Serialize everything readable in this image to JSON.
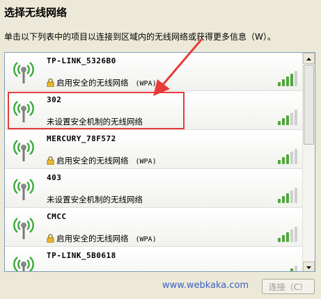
{
  "title": "选择无线网络",
  "description": "单击以下列表中的项目以连接到区域内的无线网络或获得更多信息（W）。",
  "networks": [
    {
      "ssid": "TP-LINK_5326B0",
      "status": "启用安全的无线网络",
      "security": "(WPA)",
      "secured": true,
      "signal_bars": 4
    },
    {
      "ssid": "302",
      "status": "未设置安全机制的无线网络",
      "security": "",
      "secured": false,
      "signal_bars": 3
    },
    {
      "ssid": "MERCURY_78F572",
      "status": "启用安全的无线网络",
      "security": "(WPA)",
      "secured": true,
      "signal_bars": 3
    },
    {
      "ssid": "403",
      "status": "未设置安全机制的无线网络",
      "security": "",
      "secured": false,
      "signal_bars": 3
    },
    {
      "ssid": "CMCC",
      "status": "启用安全的无线网络",
      "security": "(WPA)",
      "secured": true,
      "signal_bars": 3
    },
    {
      "ssid": "TP-LINK_5B0618",
      "status": "",
      "security": "",
      "secured": false,
      "signal_bars": 4
    }
  ],
  "footer": {
    "watermark": "www.webkaka.com",
    "connect_label": "连接（C）"
  },
  "colors": {
    "highlight": "#e73a3a",
    "signal_active": "#4fa83a",
    "signal_inactive": "#cfcfcf"
  }
}
